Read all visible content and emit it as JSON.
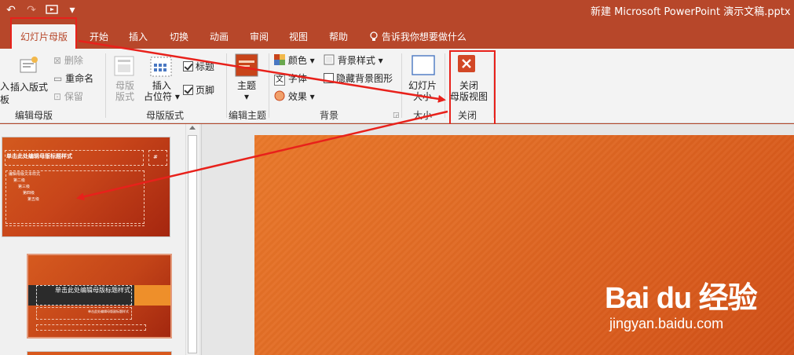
{
  "window": {
    "title": "新建 Microsoft PowerPoint 演示文稿.pptx"
  },
  "qat": {
    "undo": "↶",
    "redo": "↷",
    "slideshow": "▷",
    "customize": "▾"
  },
  "tabs": [
    "幻灯片母版",
    "开始",
    "插入",
    "切换",
    "动画",
    "审阅",
    "视图",
    "帮助"
  ],
  "tell_me": {
    "text": "告诉我你想要做什么"
  },
  "ribbon": {
    "edit_master": {
      "insert_slide_master_partial": "板",
      "insert_layout": "插入版式",
      "delete": "删除",
      "rename": "重命名",
      "preserve": "保留",
      "label": "编辑母版"
    },
    "master_layout": {
      "master_layout_btn": [
        "母版",
        "版式"
      ],
      "insert_placeholder": [
        "插入",
        "占位符"
      ],
      "title_check": "标题",
      "footer_check": "页脚",
      "label": "母版版式"
    },
    "edit_theme": {
      "themes": "主题",
      "label": "编辑主题"
    },
    "background": {
      "colors": "颜色",
      "fonts": "字体",
      "effects": "效果",
      "background_styles": "背景样式",
      "hide_bg_graphics": "隐藏背景图形",
      "label": "背景"
    },
    "size": {
      "slide_size": [
        "幻灯片",
        "大小"
      ],
      "label": "大小"
    },
    "close": {
      "close_master": [
        "关闭",
        "母版视图"
      ],
      "label": "关闭"
    }
  },
  "thumbnails": {
    "master_title": "单击此处编辑母版标题样式",
    "master_body": [
      "编辑母版文本样式",
      "第二级",
      "第三级",
      "第四级",
      "第五级"
    ],
    "layout_title": "单击此处编辑母版标题样式",
    "layout_subtitle": "单击此处编辑母版副标题样式"
  },
  "watermark": {
    "logo": "Bai du 经验",
    "url": "jingyan.baidu.com"
  },
  "colors": {
    "accent": "#b7472a",
    "annotation": "#e8211b",
    "slide": "#e06a24"
  }
}
